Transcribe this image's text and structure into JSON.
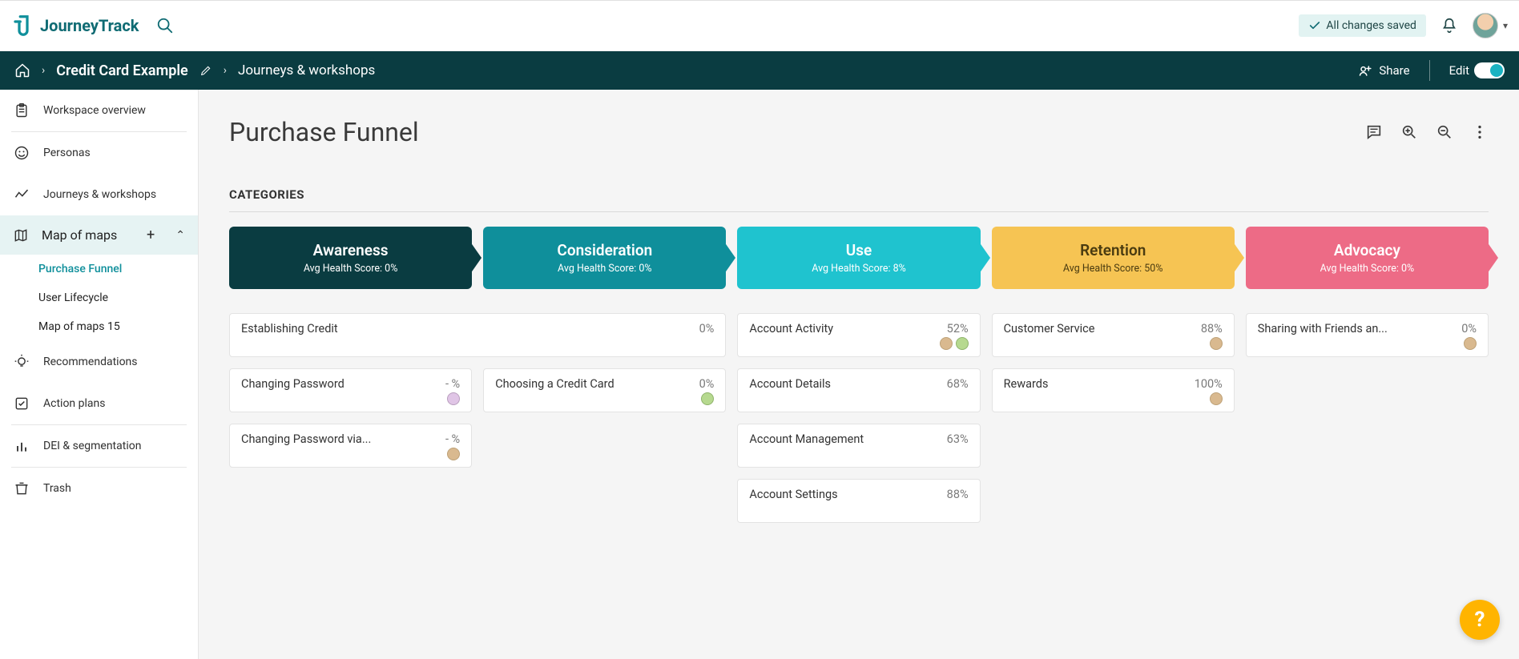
{
  "brand": {
    "name": "JourneyTrack"
  },
  "top": {
    "saved_label": "All changes saved"
  },
  "nav": {
    "workspace": "Credit Card Example",
    "section": "Journeys & workshops",
    "share": "Share",
    "edit": "Edit"
  },
  "sidebar": {
    "overview": "Workspace overview",
    "personas": "Personas",
    "journeys": "Journeys & workshops",
    "map_of_maps": "Map of maps",
    "subs": {
      "purchase_funnel": "Purchase Funnel",
      "user_lifecycle": "User Lifecycle",
      "map_of_maps_15": "Map of maps 15"
    },
    "recommendations": "Recommendations",
    "action_plans": "Action plans",
    "dei": "DEI & segmentation",
    "trash": "Trash"
  },
  "page": {
    "title": "Purchase Funnel",
    "categories_label": "CATEGORIES"
  },
  "stages": [
    {
      "name": "Awareness",
      "sub": "Avg Health Score: 0%"
    },
    {
      "name": "Consideration",
      "sub": "Avg Health Score: 0%"
    },
    {
      "name": "Use",
      "sub": "Avg Health Score: 8%"
    },
    {
      "name": "Retention",
      "sub": "Avg Health Score: 50%"
    },
    {
      "name": "Advocacy",
      "sub": "Avg Health Score: 0%"
    }
  ],
  "cards": {
    "awareness": [
      {
        "title": "Establishing Credit",
        "val": "0%",
        "personas": 0
      },
      {
        "title": "Changing Password",
        "val": "- %",
        "personas": 1
      },
      {
        "title": "Changing Password via...",
        "val": "- %",
        "personas": 1
      }
    ],
    "consideration": [
      {
        "title": "Choosing a Credit Card",
        "val": "0%",
        "personas": 1
      }
    ],
    "use": [
      {
        "title": "Account Activity",
        "val": "52%",
        "personas": 2
      },
      {
        "title": "Account Details",
        "val": "68%",
        "personas": 0
      },
      {
        "title": "Account Management",
        "val": "63%",
        "personas": 0
      },
      {
        "title": "Account Settings",
        "val": "88%",
        "personas": 0
      }
    ],
    "retention": [
      {
        "title": "Customer Service",
        "val": "88%",
        "personas": 1
      },
      {
        "title": "Rewards",
        "val": "100%",
        "personas": 1
      }
    ],
    "advocacy": [
      {
        "title": "Sharing with Friends an...",
        "val": "0%",
        "personas": 1
      }
    ]
  }
}
